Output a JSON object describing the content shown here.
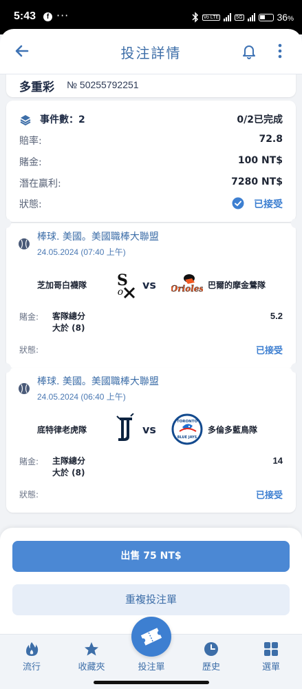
{
  "statusbar": {
    "time": "5:43",
    "app_icon": "f",
    "dots": "···",
    "battery_text": "36",
    "icons": [
      "bluetooth-icon",
      "wifi-icon",
      "signal-icon",
      "5g-signal-icon",
      "battery-icon"
    ],
    "tags": [
      "Vo LTE",
      "5G"
    ]
  },
  "appbar": {
    "title": "投注詳情",
    "icons": [
      "back-arrow-icon",
      "bell-icon",
      "more-vertical-icon"
    ]
  },
  "ticket": {
    "type": "多重彩",
    "number": "№ 50255792251"
  },
  "summary": {
    "events_label": "事件數：",
    "events_count": "2",
    "progress": "0/2已完成",
    "rows": [
      {
        "label": "賠率:",
        "value": "72.8"
      },
      {
        "label": "賭金:",
        "value": "100 NT$"
      },
      {
        "label": "潛在贏利:",
        "value": "7280 NT$"
      }
    ],
    "status_label": "狀態:",
    "status_value": "已接受"
  },
  "events": [
    {
      "league": "棒球. 美國。美國職棒大聯盟",
      "datetime": "24.05.2024 (07:40 上午)",
      "home": "芝加哥白襪隊",
      "vs": "vs",
      "away": "巴爾的摩金鶯隊",
      "stake_label": "賭金:",
      "selection_line1": "客隊總分",
      "selection_line2": "大於 (8)",
      "odds": "5.2",
      "status_label": "狀態:",
      "status_value": "已接受",
      "home_logo": "white-sox-logo",
      "away_logo": "orioles-logo"
    },
    {
      "league": "棒球. 美國。美國職棒大聯盟",
      "datetime": "24.05.2024 (06:40 上午)",
      "home": "底特律老虎隊",
      "vs": "vs",
      "away": "多倫多藍鳥隊",
      "stake_label": "賭金:",
      "selection_line1": "主隊總分",
      "selection_line2": "大於 (8)",
      "odds": "14",
      "status_label": "狀態:",
      "status_value": "已接受",
      "home_logo": "tigers-logo",
      "away_logo": "blue-jays-logo",
      "away_logo_text": "TORONTO",
      "away_logo_text2": "BLUE JAYS"
    }
  ],
  "actions": {
    "sell": "出售 75 NT$",
    "repeat": "重複投注單"
  },
  "tabs": [
    {
      "label": "流行",
      "icon": "flame-icon"
    },
    {
      "label": "收藏夾",
      "icon": "star-icon"
    },
    {
      "label": "投注單",
      "icon": "ticket-icon"
    },
    {
      "label": "歷史",
      "icon": "clock-icon"
    },
    {
      "label": "選單",
      "icon": "grid-menu-icon"
    }
  ],
  "colors": {
    "accent": "#3d7fd1",
    "title": "#3d6ea8",
    "background": "#f1f3f6"
  }
}
